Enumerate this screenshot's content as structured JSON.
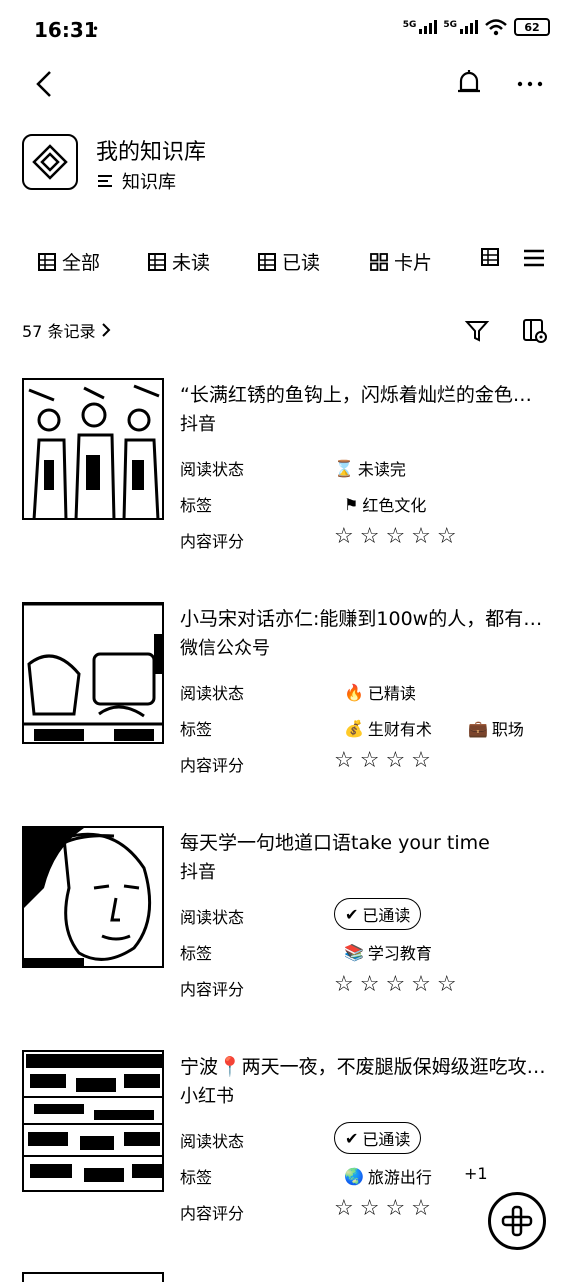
{
  "status_bar": {
    "time": "16:31",
    "dot": "•",
    "net1": "5G",
    "net2": "5G",
    "battery": "62"
  },
  "header": {
    "title": "我的知识库",
    "subtitle": "知识库"
  },
  "tabs": [
    {
      "label": "全部"
    },
    {
      "label": "未读"
    },
    {
      "label": "已读"
    },
    {
      "label": "卡片"
    }
  ],
  "records": {
    "label": "57 条记录"
  },
  "fields": {
    "read_status": "阅读状态",
    "tags": "标签",
    "rating": "内容评分"
  },
  "items": [
    {
      "title": "“长满红锈的鱼钩上，闪烁着灿烂的金色…",
      "source": "抖音",
      "status": "未读完",
      "tags": [
        "红色文化"
      ],
      "extra": "",
      "stars": "☆☆☆☆☆"
    },
    {
      "title": "小马宋对话亦仁:能赚到100w的人，都有…",
      "source": "微信公众号",
      "status": "已精读",
      "tags": [
        "生财有术",
        "职场"
      ],
      "extra": "",
      "stars": "☆☆☆☆"
    },
    {
      "title": "每天学一句地道口语take your time",
      "source": "抖音",
      "status": "已通读",
      "tags": [
        "学习教育"
      ],
      "extra": "",
      "stars": "☆☆☆☆☆"
    },
    {
      "title": "宁波📍两天一夜，不废腿版保姆级逛吃攻…",
      "source": "小红书",
      "status": "已通读",
      "tags": [
        "旅游出行"
      ],
      "extra": "+1",
      "stars": "☆☆☆☆"
    }
  ]
}
